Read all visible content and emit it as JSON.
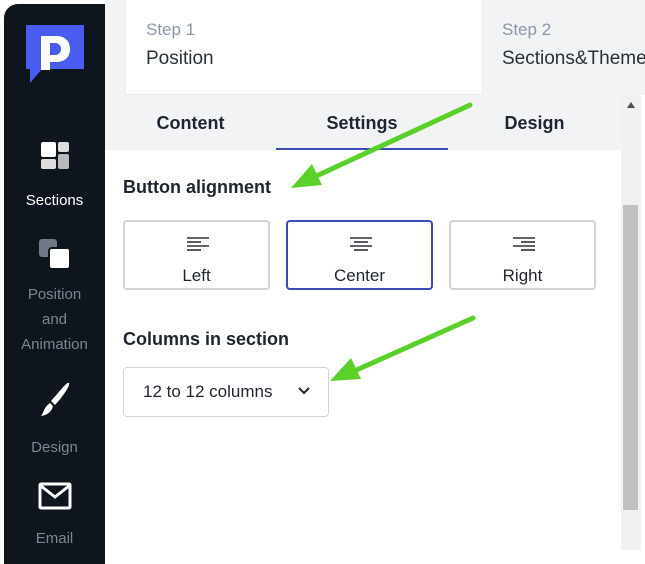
{
  "sidebar": {
    "items": [
      {
        "label": "Sections",
        "icon": "sections-icon",
        "active": true
      },
      {
        "label": "Position and Animation",
        "icon": "position-animation-icon",
        "active": false
      },
      {
        "label": "Design",
        "icon": "brush-icon",
        "active": false
      },
      {
        "label": "Email",
        "icon": "envelope-icon",
        "active": false
      }
    ],
    "position_line1": "Position",
    "position_line2": "and",
    "position_line3": "Animation"
  },
  "steps": [
    {
      "number": "Step 1",
      "name": "Position"
    },
    {
      "number": "Step 2",
      "name": "Sections&Theme"
    }
  ],
  "tabs": [
    {
      "label": "Content"
    },
    {
      "label": "Settings"
    },
    {
      "label": "Design"
    }
  ],
  "settings": {
    "button_alignment": {
      "title": "Button alignment",
      "options": [
        "Left",
        "Center",
        "Right"
      ],
      "selected": "Center"
    },
    "columns": {
      "title": "Columns in section",
      "value": "12 to 12 columns"
    }
  },
  "colors": {
    "sidebar_bg": "#0e151c",
    "accent": "#3b4bb5",
    "logo": "#4a5bf0",
    "arrow": "#5ad12a"
  }
}
